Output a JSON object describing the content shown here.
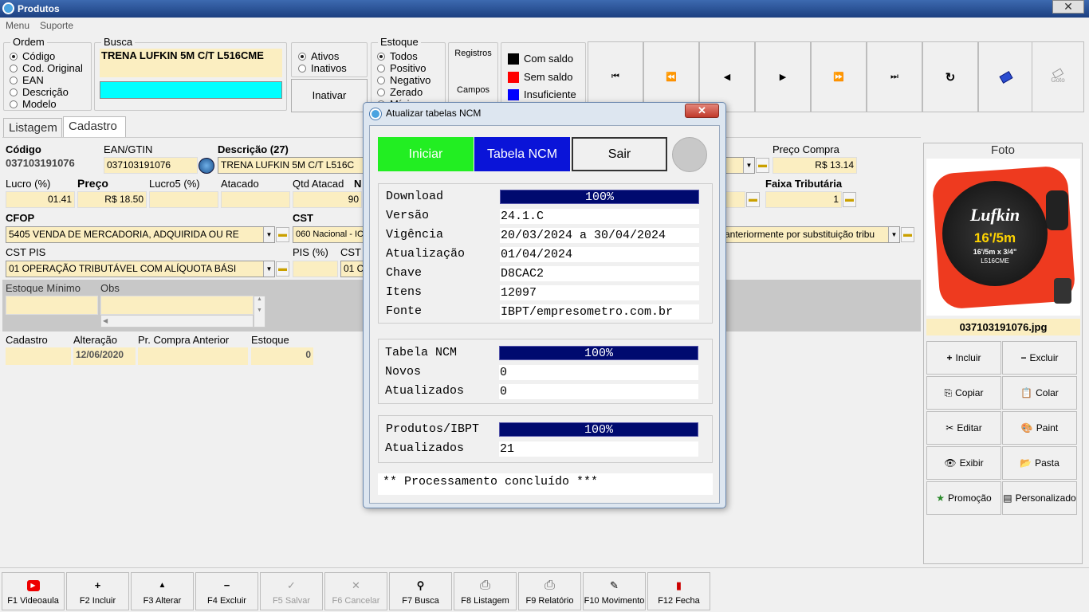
{
  "window": {
    "title": "Produtos",
    "close_glyph": "✕"
  },
  "menu": [
    "Menu",
    "Suporte"
  ],
  "ordem": {
    "label": "Ordem",
    "options": [
      "Código",
      "Cod. Original",
      "EAN",
      "Descrição",
      "Modelo"
    ],
    "selected": 0
  },
  "busca": {
    "label": "Busca",
    "value": "TRENA LUFKIN 5M C/T L516CME",
    "search_value": ""
  },
  "status": {
    "options": [
      "Ativos",
      "Inativos"
    ],
    "selected": 0,
    "inativar_label": "Inativar"
  },
  "estoque": {
    "label": "Estoque",
    "options": [
      "Todos",
      "Positivo",
      "Negativo",
      "Zerado",
      "Mínimo"
    ],
    "selected": 0
  },
  "registros": {
    "registros_label": "Registros",
    "campos_label": "Campos"
  },
  "legend": [
    {
      "label": "Com saldo",
      "color": "#000000"
    },
    {
      "label": "Sem saldo",
      "color": "#ff0000"
    },
    {
      "label": "Insuficiente",
      "color": "#0000ff"
    }
  ],
  "nav": {
    "first": "⏮",
    "prev_page": "⏪",
    "prev": "◀",
    "next": "▶",
    "next_page": "⏩",
    "last": "⏭",
    "refresh": "↻",
    "goto": "Goto"
  },
  "tabs": [
    "Listagem",
    "Cadastro"
  ],
  "form": {
    "codigo_label": "Código",
    "codigo": "037103191076",
    "ean_label": "EAN/GTIN",
    "ean": "037103191076",
    "descricao_label": "Descrição (27)",
    "descricao": "TRENA LUFKIN 5M C/T L516C",
    "preco_compra_label": "Preço Compra",
    "preco_compra": "R$ 13.14",
    "lucro_label": "Lucro (%)",
    "lucro": "01.41",
    "preco_label": "Preço",
    "preco": "R$ 18.50",
    "lucro5_label": "Lucro5 (%)",
    "lucro5": "",
    "atacado_label": "Atacado",
    "atacado": "",
    "qtd_atacado_label": "Qtd Atacad",
    "qtd_atacado": "90",
    "n_label": "N",
    "faixa_label": "Faixa Tributária",
    "faixa": "1",
    "cfop_label": "CFOP",
    "cfop": "5405 VENDA DE MERCADORIA, ADQUIRIDA OU RE",
    "cst_label": "CST",
    "cst": "060 Nacional - IC",
    "cst_desc": "anteriormente por substituição tribu",
    "cst_pis_label": "CST PIS",
    "cst_pis": "01 OPERAÇÃO TRIBUTÁVEL COM ALÍQUOTA BÁSI",
    "pis_label": "PIS (%)",
    "pis": "",
    "cst2_label": "CST",
    "cst2": "01 C",
    "estoque_minimo_label": "Estoque Mínimo",
    "estoque_minimo": "",
    "obs_label": "Obs",
    "obs": "",
    "cadastro_label": "Cadastro",
    "cadastro": "",
    "alteracao_label": "Alteração",
    "alteracao": "12/06/2020",
    "pr_compra_anterior_label": "Pr. Compra Anterior",
    "pr_compra_anterior": "",
    "estoque_label": "Estoque",
    "estoque": "0"
  },
  "photo": {
    "label": "Foto",
    "filename": "037103191076.jpg",
    "brand": "Lufkin",
    "size": "16'/5m",
    "spec": "16'/5m x 3/4\"",
    "model": "L516CME"
  },
  "side_buttons": [
    {
      "label": "Incluir",
      "icon": "+"
    },
    {
      "label": "Excluir",
      "icon": "−"
    },
    {
      "label": "Copiar",
      "icon": "⎘"
    },
    {
      "label": "Colar",
      "icon": "📋"
    },
    {
      "label": "Editar",
      "icon": "✂"
    },
    {
      "label": "Paint",
      "icon": "🎨"
    },
    {
      "label": "Exibir",
      "icon": "👁"
    },
    {
      "label": "Pasta",
      "icon": "📂"
    },
    {
      "label": "Promoção",
      "icon": "★"
    },
    {
      "label": "Personalizado",
      "icon": "▤"
    }
  ],
  "fkeys": [
    {
      "label": "F1 Videoaula",
      "icon": "▶",
      "enabled": true
    },
    {
      "label": "F2 Incluir",
      "icon": "+",
      "enabled": true
    },
    {
      "label": "F3 Alterar",
      "icon": "▲",
      "enabled": true
    },
    {
      "label": "F4 Excluir",
      "icon": "−",
      "enabled": true
    },
    {
      "label": "F5 Salvar",
      "icon": "✓",
      "enabled": false
    },
    {
      "label": "F6 Cancelar",
      "icon": "✕",
      "enabled": false
    },
    {
      "label": "F7 Busca",
      "icon": "⚲",
      "enabled": true
    },
    {
      "label": "F8 Listagem",
      "icon": "⎙",
      "enabled": true
    },
    {
      "label": "F9 Relatório",
      "icon": "⎙",
      "enabled": true
    },
    {
      "label": "F10 Movimento",
      "icon": "✎",
      "enabled": true
    },
    {
      "label": "F12 Fecha",
      "icon": "▮",
      "enabled": true
    }
  ],
  "dialog": {
    "title": "Atualizar tabelas NCM",
    "close_glyph": "✕",
    "buttons": {
      "iniciar": "Iniciar",
      "tabela": "Tabela NCM",
      "sair": "Sair"
    },
    "download": {
      "label": "Download",
      "progress": "100%"
    },
    "info": [
      {
        "label": "Versão",
        "value": "24.1.C"
      },
      {
        "label": "Vigência",
        "value": "20/03/2024 a 30/04/2024"
      },
      {
        "label": "Atualização",
        "value": "01/04/2024"
      },
      {
        "label": "Chave",
        "value": "D8CAC2"
      },
      {
        "label": "Itens",
        "value": "12097"
      },
      {
        "label": "Fonte",
        "value": "IBPT/empresometro.com.br"
      }
    ],
    "tabela": {
      "label": "Tabela NCM",
      "progress": "100%",
      "novos_label": "Novos",
      "novos": "0",
      "atualizados_label": "Atualizados",
      "atualizados": "0"
    },
    "produtos": {
      "label": "Produtos/IBPT",
      "progress": "100%",
      "atualizados_label": "Atualizados",
      "atualizados": "21"
    },
    "message": "** Processamento concluído ***"
  }
}
